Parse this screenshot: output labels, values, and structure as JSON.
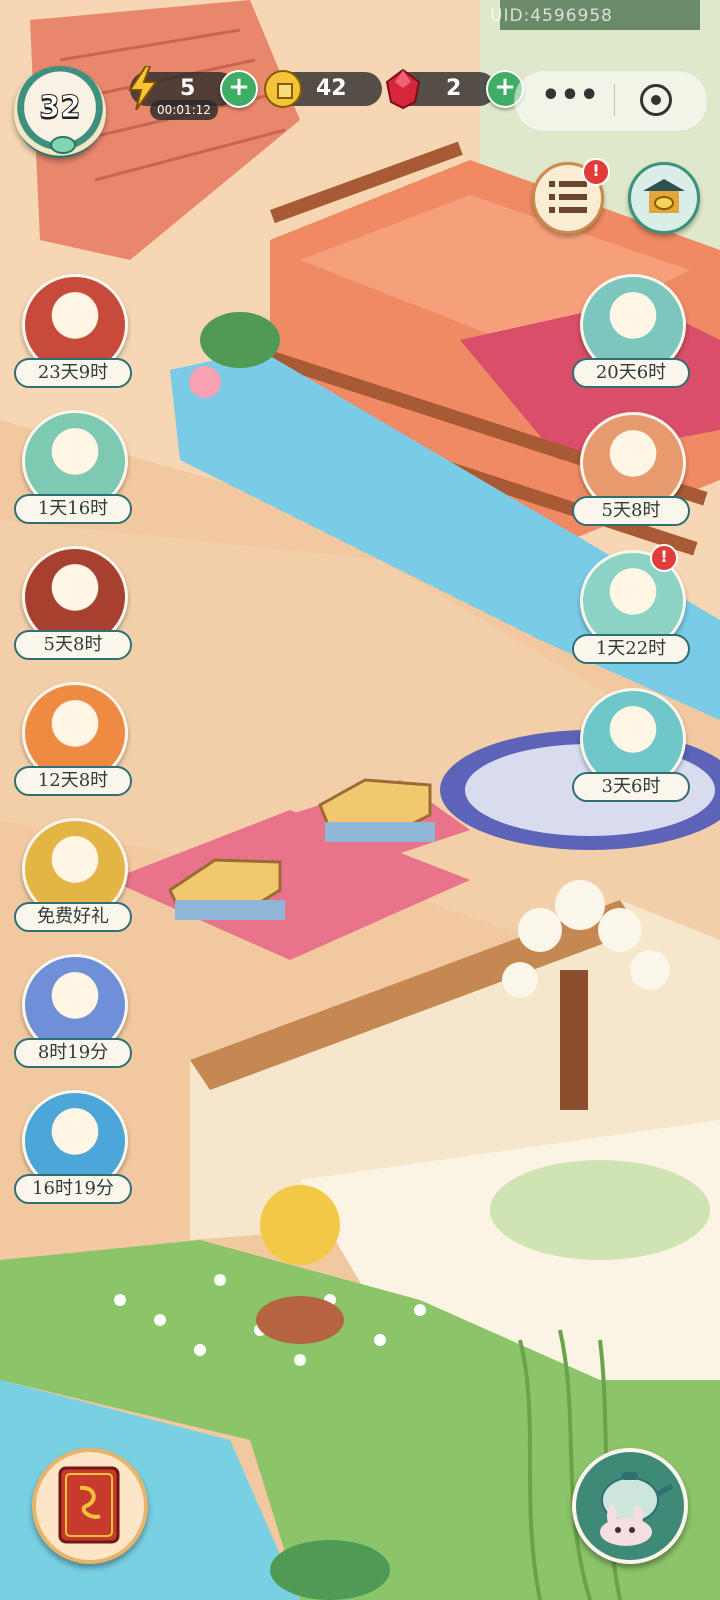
{
  "hud": {
    "level": "32",
    "energy": "5",
    "energy_timer": "00:01:12",
    "coins": "42",
    "gems": "2",
    "uid": "UID:4596958"
  },
  "left_events": [
    {
      "id": "event-book",
      "label": "23天9时",
      "icon": "book-gift-icon",
      "color": "#c84a3a"
    },
    {
      "id": "event-lucky-cat",
      "label": "1天16时",
      "icon": "lucky-cat-icon",
      "color": "#7ec9b2"
    },
    {
      "id": "event-tea-pot",
      "label": "5天8时",
      "icon": "teapot-icon",
      "color": "#a8402f"
    },
    {
      "id": "event-koi-bowl",
      "label": "12天8时",
      "icon": "koi-bowl-icon",
      "color": "#ef8a43"
    },
    {
      "id": "event-free-gift",
      "label": "免费好礼",
      "icon": "lucky-charm-icon",
      "color": "#e2b545"
    },
    {
      "id": "event-fishing-cat",
      "label": "8时19分",
      "icon": "fishing-cat-icon",
      "color": "#6f8fd8"
    },
    {
      "id": "event-fish",
      "label": "16时19分",
      "icon": "fish-icon",
      "color": "#4aa7d8"
    }
  ],
  "right_events": [
    {
      "id": "event-bath-cat",
      "label": "20天6时",
      "icon": "bath-cat-icon",
      "color": "#7cc6bd"
    },
    {
      "id": "event-fan-cat",
      "label": "5天8时",
      "icon": "fan-cat-icon",
      "color": "#e89a6f"
    },
    {
      "id": "event-coin-cat",
      "label": "1天22时",
      "icon": "coin-cat-icon",
      "color": "#8dd3c4",
      "alert": "!"
    },
    {
      "id": "event-gift-cat",
      "label": "3天6时",
      "icon": "gift-box-cat-icon",
      "color": "#6fc7c9"
    }
  ],
  "top_buttons": {
    "task_alert": "!"
  },
  "colors": {
    "teal": "#2f6f73",
    "plus_green": "#3fae64",
    "alert_red": "#e23b3b"
  }
}
